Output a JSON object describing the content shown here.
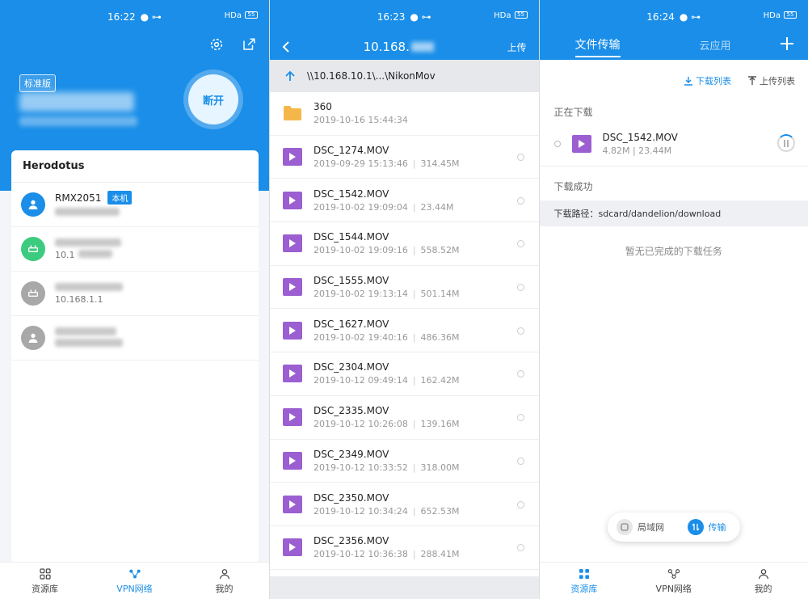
{
  "panel1": {
    "status_time": "16:22",
    "battery": "55",
    "network_label": "HDa",
    "edition": "标准版",
    "disconnect_label": "断开",
    "network_name": "Herodotus",
    "devices": [
      {
        "name": "RMX2051",
        "badge": "本机",
        "ip": "",
        "color": "#1a8ee8"
      },
      {
        "name": "",
        "ip": "10.1",
        "color": "#3ccb7f"
      },
      {
        "name": "",
        "ip": "10.168.1.1",
        "color": "#a8a8a8"
      },
      {
        "name": "",
        "ip": "",
        "color": "#a8a8a8"
      }
    ],
    "tabs": [
      "资源库",
      "VPN网络",
      "我的"
    ]
  },
  "panel2": {
    "status_time": "16:23",
    "battery": "55",
    "network_label": "HDa",
    "title": "10.168.",
    "upload_label": "上传",
    "path": "\\\\10.168.10.1\\...\\NikonMov",
    "files": [
      {
        "name": "360",
        "date": "2019-10-16 15:44:34",
        "size": "",
        "type": "folder"
      },
      {
        "name": "DSC_1274.MOV",
        "date": "2019-09-29 15:13:46",
        "size": "314.45M",
        "type": "video"
      },
      {
        "name": "DSC_1542.MOV",
        "date": "2019-10-02 19:09:04",
        "size": "23.44M",
        "type": "video"
      },
      {
        "name": "DSC_1544.MOV",
        "date": "2019-10-02 19:09:16",
        "size": "558.52M",
        "type": "video"
      },
      {
        "name": "DSC_1555.MOV",
        "date": "2019-10-02 19:13:14",
        "size": "501.14M",
        "type": "video"
      },
      {
        "name": "DSC_1627.MOV",
        "date": "2019-10-02 19:40:16",
        "size": "486.36M",
        "type": "video"
      },
      {
        "name": "DSC_2304.MOV",
        "date": "2019-10-12 09:49:14",
        "size": "162.42M",
        "type": "video"
      },
      {
        "name": "DSC_2335.MOV",
        "date": "2019-10-12 10:26:08",
        "size": "139.16M",
        "type": "video"
      },
      {
        "name": "DSC_2349.MOV",
        "date": "2019-10-12 10:33:52",
        "size": "318.00M",
        "type": "video"
      },
      {
        "name": "DSC_2350.MOV",
        "date": "2019-10-12 10:34:24",
        "size": "652.53M",
        "type": "video"
      },
      {
        "name": "DSC_2356.MOV",
        "date": "2019-10-12 10:36:38",
        "size": "288.41M",
        "type": "video"
      }
    ]
  },
  "panel3": {
    "status_time": "16:24",
    "battery": "55",
    "network_label": "HDa",
    "tab_active": "文件传输",
    "tab_other": "云应用",
    "download_list": "下载列表",
    "upload_list": "上传列表",
    "downloading": "正在下载",
    "transfer_name": "DSC_1542.MOV",
    "transfer_progress": "4.82M | 23.44M",
    "download_done": "下载成功",
    "download_path": "下载路径：sdcard/dandelion/download",
    "empty_text": "暂无已完成的下载任务",
    "pill_lan": "局域网",
    "pill_transfer": "传输",
    "tabs": [
      "资源库",
      "VPN网络",
      "我的"
    ]
  },
  "colors": {
    "accent": "#1a8ee8",
    "video": "#9b5fd1",
    "folder": "#f5b74a"
  }
}
